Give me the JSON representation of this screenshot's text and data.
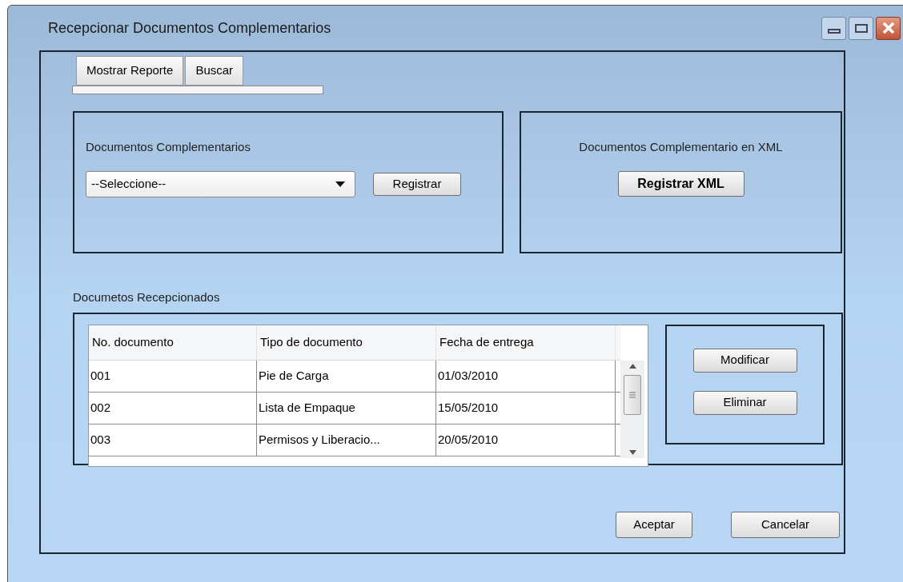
{
  "window": {
    "title": "Recepcionar Documentos Complementarios"
  },
  "tabs": [
    {
      "label": "Mostrar Reporte",
      "selected": false
    },
    {
      "label": "Buscar",
      "selected": false
    }
  ],
  "complementary_group": {
    "title": "Documentos Complementarios",
    "select_value": "--Seleccione--",
    "button": "Registrar"
  },
  "xml_group": {
    "title": "Documentos Complementario en XML",
    "button": "Registrar XML"
  },
  "received": {
    "title": "Documetos Recepcionados",
    "columns": [
      "No. documento",
      "Tipo de documento",
      "Fecha de entrega"
    ],
    "rows": [
      [
        "001",
        "Pie de Carga",
        "01/03/2010"
      ],
      [
        "002",
        "Lista de Empaque",
        "15/05/2010"
      ],
      [
        "003",
        "Permisos y Liberacio...",
        "20/05/2010"
      ]
    ],
    "buttons": [
      "Modificar",
      "Eliminar"
    ]
  },
  "footer_buttons": [
    "Aceptar",
    "Cancelar"
  ]
}
